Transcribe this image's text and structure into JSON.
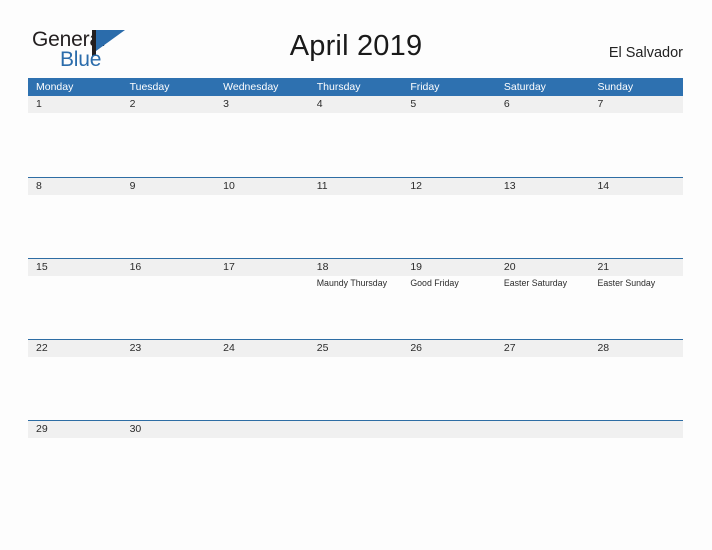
{
  "logo": {
    "word_top": "General",
    "word_bottom": "Blue",
    "mark": "triangle-flag-icon",
    "colors": {
      "text": "#231f20",
      "blue": "#2b6cab"
    }
  },
  "header": {
    "title": "April 2019",
    "country": "El Salvador"
  },
  "theme": {
    "header_blue": "#2e71b0",
    "row_line_blue": "#2e6da4",
    "day_band_gray": "#f0f0f0",
    "page_background": "#fdfdfd"
  },
  "calendar": {
    "weekdays": [
      "Monday",
      "Tuesday",
      "Wednesday",
      "Thursday",
      "Friday",
      "Saturday",
      "Sunday"
    ],
    "weeks": [
      [
        {
          "day": "1",
          "event": ""
        },
        {
          "day": "2",
          "event": ""
        },
        {
          "day": "3",
          "event": ""
        },
        {
          "day": "4",
          "event": ""
        },
        {
          "day": "5",
          "event": ""
        },
        {
          "day": "6",
          "event": ""
        },
        {
          "day": "7",
          "event": ""
        }
      ],
      [
        {
          "day": "8",
          "event": ""
        },
        {
          "day": "9",
          "event": ""
        },
        {
          "day": "10",
          "event": ""
        },
        {
          "day": "11",
          "event": ""
        },
        {
          "day": "12",
          "event": ""
        },
        {
          "day": "13",
          "event": ""
        },
        {
          "day": "14",
          "event": ""
        }
      ],
      [
        {
          "day": "15",
          "event": ""
        },
        {
          "day": "16",
          "event": ""
        },
        {
          "day": "17",
          "event": ""
        },
        {
          "day": "18",
          "event": "Maundy Thursday"
        },
        {
          "day": "19",
          "event": "Good Friday"
        },
        {
          "day": "20",
          "event": "Easter Saturday"
        },
        {
          "day": "21",
          "event": "Easter Sunday"
        }
      ],
      [
        {
          "day": "22",
          "event": ""
        },
        {
          "day": "23",
          "event": ""
        },
        {
          "day": "24",
          "event": ""
        },
        {
          "day": "25",
          "event": ""
        },
        {
          "day": "26",
          "event": ""
        },
        {
          "day": "27",
          "event": ""
        },
        {
          "day": "28",
          "event": ""
        }
      ],
      [
        {
          "day": "29",
          "event": ""
        },
        {
          "day": "30",
          "event": ""
        },
        {
          "day": "",
          "event": ""
        },
        {
          "day": "",
          "event": ""
        },
        {
          "day": "",
          "event": ""
        },
        {
          "day": "",
          "event": ""
        },
        {
          "day": "",
          "event": ""
        }
      ]
    ]
  }
}
